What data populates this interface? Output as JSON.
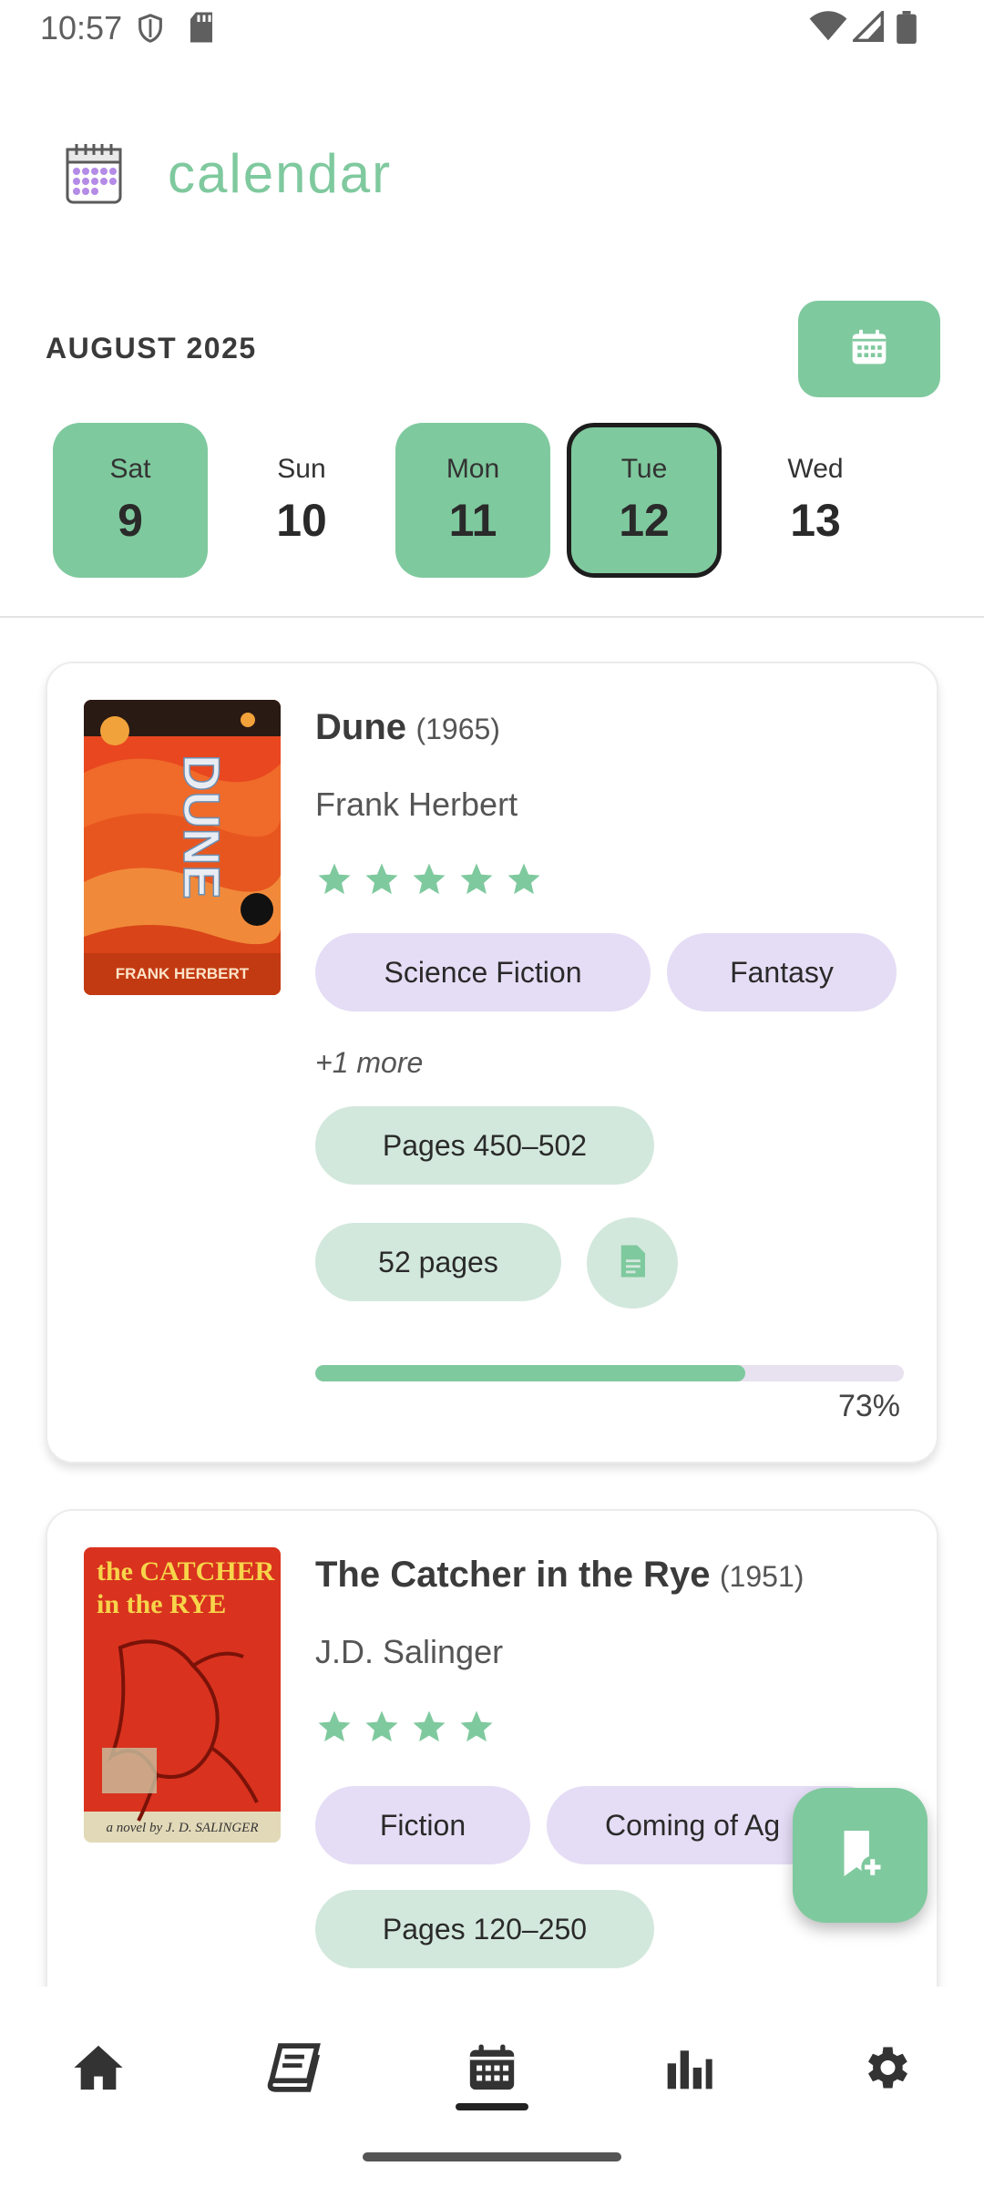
{
  "status_bar": {
    "time": "10:57",
    "icons": [
      "shield-icon",
      "sd-card-icon",
      "wifi-icon",
      "cell-signal-icon",
      "battery-icon"
    ]
  },
  "header": {
    "title": "calendar",
    "logo_icon": "calendar-icon"
  },
  "calendar": {
    "month_label": "AUGUST 2025",
    "picker_icon": "calendar-icon",
    "days": [
      {
        "name": "Sat",
        "num": "9",
        "state": "filled"
      },
      {
        "name": "Sun",
        "num": "10",
        "state": "empty"
      },
      {
        "name": "Mon",
        "num": "11",
        "state": "filled"
      },
      {
        "name": "Tue",
        "num": "12",
        "state": "today"
      },
      {
        "name": "Wed",
        "num": "13",
        "state": "empty"
      }
    ]
  },
  "books": [
    {
      "title": "Dune",
      "year": "(1965)",
      "author": "Frank Herbert",
      "rating": 5,
      "genres": [
        "Science Fiction",
        "Fantasy"
      ],
      "more_genres": "+1 more",
      "pages_range": "Pages 450–502",
      "pages_count": "52 pages",
      "progress_percent": 73,
      "progress_label": "73%",
      "cover_title": "DUNE",
      "cover_author": "FRANK HERBERT"
    },
    {
      "title": "The Catcher in the Rye",
      "year": "(1951)",
      "author": "J.D. Salinger",
      "rating": 4,
      "genres": [
        "Fiction",
        "Coming of Ag"
      ],
      "pages_range": "Pages 120–250",
      "cover_title_line1": "the CATCHER",
      "cover_title_line2": "in the RYE",
      "cover_author": "a novel by J. D. SALINGER"
    }
  ],
  "fab": {
    "icon": "add-bookmark-icon"
  },
  "bottom_nav": {
    "items": [
      "home-icon",
      "book-icon",
      "calendar-icon",
      "stats-icon",
      "settings-icon"
    ],
    "active_index": 2
  },
  "colors": {
    "accent": "#7fc99e",
    "genre_chip": "#e5ddf5",
    "meta_chip": "#d3e8dd"
  }
}
